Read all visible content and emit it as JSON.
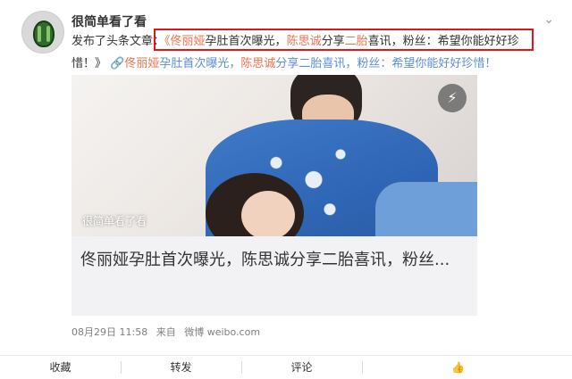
{
  "post": {
    "username": "很简单看了看",
    "text_prefix": "发布了头条文章：",
    "title_parts": [
      "《",
      "佟丽娅",
      "孕肚首次曝光，",
      "陈思诚",
      "分享",
      "二胎",
      "喜讯，粉丝：希望你能好好珍",
      "惜！》"
    ],
    "link_icon": "link-icon",
    "link_parts": [
      "佟丽娅",
      "孕肚首次曝光，",
      "陈思诚",
      "分享二胎喜讯，粉丝：希望你能好好珍惜！"
    ],
    "timestamp": "08月29日 11:58",
    "source_prefix": "来自",
    "source": "微博 weibo.com"
  },
  "card": {
    "watermark": "很简单看了看",
    "title": "佟丽娅孕肚首次曝光，陈思诚分享二胎喜讯，粉丝...",
    "play_icon": "lightning-icon"
  },
  "actions": {
    "collect": "收藏",
    "repost": "转发",
    "comment": "评论",
    "like_icon": "thumbs-up-icon"
  },
  "colors": {
    "highlight": "#eb7350",
    "link": "#5d8fd8",
    "annotation_box": "#e0161b"
  }
}
